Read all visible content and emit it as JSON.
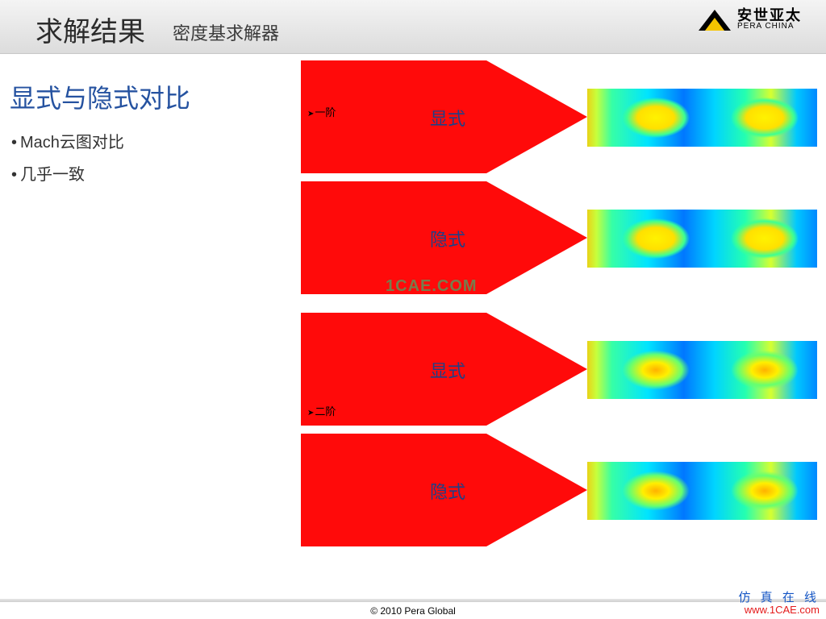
{
  "header": {
    "title": "求解结果",
    "subtitle": "密度基求解器",
    "logo_cn": "安世亚太",
    "logo_en": "PERA CHINA"
  },
  "content": {
    "section_title": "显式与隐式对比",
    "bullets": [
      "Mach云图对比",
      "几乎一致"
    ]
  },
  "figures": {
    "group1": {
      "order_label": "一阶",
      "explicit_label": "显式",
      "implicit_label": "隐式",
      "watermark": "1CAE.COM"
    },
    "group2": {
      "order_label": "二阶",
      "explicit_label": "显式",
      "implicit_label": "隐式"
    }
  },
  "footer": {
    "copyright": "© 2010 Pera Global",
    "stamp_cn": "仿 真 在 线",
    "stamp_url": "www.1CAE.com"
  }
}
